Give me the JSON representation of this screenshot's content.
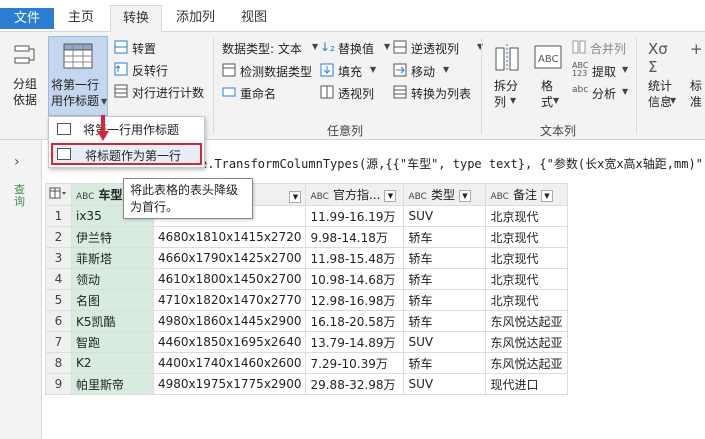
{
  "tabs": [
    "文件",
    "主页",
    "转换",
    "添加列",
    "视图"
  ],
  "ribbon": {
    "group_by": "分组\n依据",
    "use_first_row": "将第一行\n用作标题",
    "transpose": "转置",
    "reverse_rows": "反转行",
    "count_rows": "对行进行计数",
    "data_type": "数据类型: 文本",
    "detect_type": "检测数据类型",
    "rename": "重命名",
    "replace_values": "替换值",
    "fill": "填充",
    "pivot_column": "透视列",
    "unpivot_columns": "逆透视列",
    "move": "移动",
    "to_list": "转换为列表",
    "any_column_label": "任意列",
    "split_column": "拆分\n列",
    "format": "格\n式",
    "merge_columns": "合并列",
    "extract": "提取",
    "parse": "分析",
    "text_column_label": "文本列",
    "statistics": "统计\n信息",
    "standard": "标\n准"
  },
  "menu": {
    "items": [
      "将第一行用作标题",
      "将标题作为第一行"
    ]
  },
  "formula": "e.TransformColumnTypes(源,{{\"车型\", type text}, {\"参数(长x宽x高x轴距,mm)\", type",
  "tooltip": "将此表格的表头降级为首行。",
  "leftnav_label": "查询",
  "table": {
    "headers": [
      "车型",
      "",
      "官方指...",
      "类型",
      "备注"
    ],
    "rows": [
      [
        "1",
        "ix35",
        "",
        "11.99-16.19万",
        "SUV",
        "北京现代"
      ],
      [
        "2",
        "伊兰特",
        "4680x1810x1415x2720",
        "9.98-14.18万",
        "轿车",
        "北京现代"
      ],
      [
        "3",
        "菲斯塔",
        "4660x1790x1425x2700",
        "11.98-15.48万",
        "轿车",
        "北京现代"
      ],
      [
        "4",
        "领动",
        "4610x1800x1450x2700",
        "10.98-14.68万",
        "轿车",
        "北京现代"
      ],
      [
        "5",
        "名图",
        "4710x1820x1470x2770",
        "12.98-16.98万",
        "轿车",
        "北京现代"
      ],
      [
        "6",
        "K5凯酷",
        "4980x1860x1445x2900",
        "16.18-20.58万",
        "轿车",
        "东风悦达起亚"
      ],
      [
        "7",
        "智跑",
        "4460x1850x1695x2640",
        "13.79-14.89万",
        "SUV",
        "东风悦达起亚"
      ],
      [
        "8",
        "K2",
        "4400x1740x1460x2600",
        "7.29-10.39万",
        "轿车",
        "东风悦达起亚"
      ],
      [
        "9",
        "帕里斯帝",
        "4980x1975x1775x2900",
        "29.88-32.98万",
        "SUV",
        "现代进口"
      ]
    ]
  }
}
